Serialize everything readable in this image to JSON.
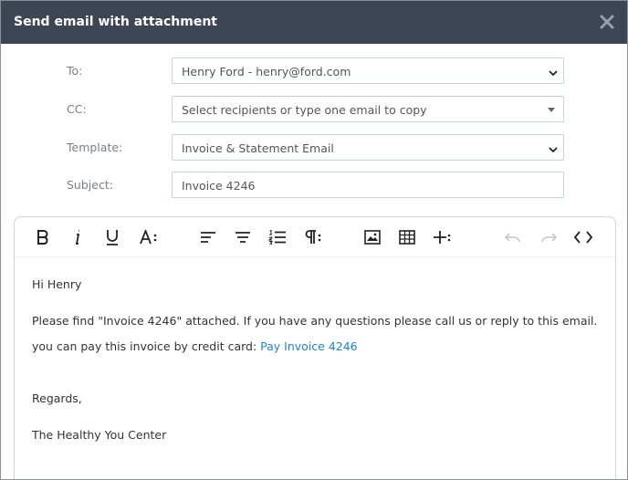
{
  "dialog": {
    "title": "Send email with attachment"
  },
  "form": {
    "to": {
      "label": "To:",
      "value": "Henry Ford - henry@ford.com"
    },
    "cc": {
      "label": "CC:",
      "placeholder": "Select recipients or type one email to copy"
    },
    "template": {
      "label": "Template:",
      "value": "Invoice & Statement Email"
    },
    "subject": {
      "label": "Subject:",
      "value": "Invoice 4246"
    }
  },
  "toolbar": {
    "icons": [
      "bold-icon",
      "italic-icon",
      "underline-icon",
      "font-size-icon",
      "align-left-icon",
      "align-center-icon",
      "ordered-list-icon",
      "paragraph-icon",
      "image-icon",
      "table-icon",
      "insert-more-icon",
      "undo-icon",
      "redo-icon",
      "code-view-icon"
    ]
  },
  "body": {
    "greeting": "Hi Henry",
    "line1": "Please find \"Invoice 4246\" attached. If you have any questions please call us or reply to this email.",
    "line2_prefix": "you can pay this invoice by credit card: ",
    "pay_link": "Pay Invoice 4246",
    "regards": "Regards,",
    "signature": "The Healthy You Center"
  },
  "colors": {
    "header_bg": "#3d4655",
    "link": "#1a85d6",
    "field_border": "#c7d3dd"
  }
}
